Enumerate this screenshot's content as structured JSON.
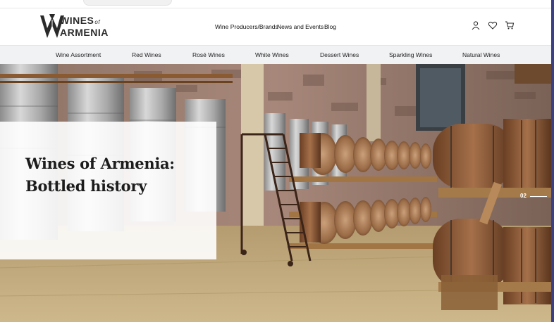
{
  "brand": {
    "line1": "WINES",
    "line1_suffix": "of",
    "line2": "ARMENIA"
  },
  "nav": {
    "items": [
      "Wine Producers/Brands",
      "News and Events",
      "Blog"
    ]
  },
  "header_icons": [
    "user-icon",
    "heart-icon",
    "cart-icon"
  ],
  "categories": [
    "Wine Assortment",
    "Red Wines",
    "Rosé Wines",
    "White Wines",
    "Dessert Wines",
    "Sparkling Wines",
    "Natural Wines"
  ],
  "hero": {
    "title": "Wines of Armenia: Bottled history",
    "slide_number": "02"
  },
  "colors": {
    "accent_bar": "#3a3f86",
    "category_bg": "#f1f2f4",
    "text": "#1a1a1a"
  }
}
